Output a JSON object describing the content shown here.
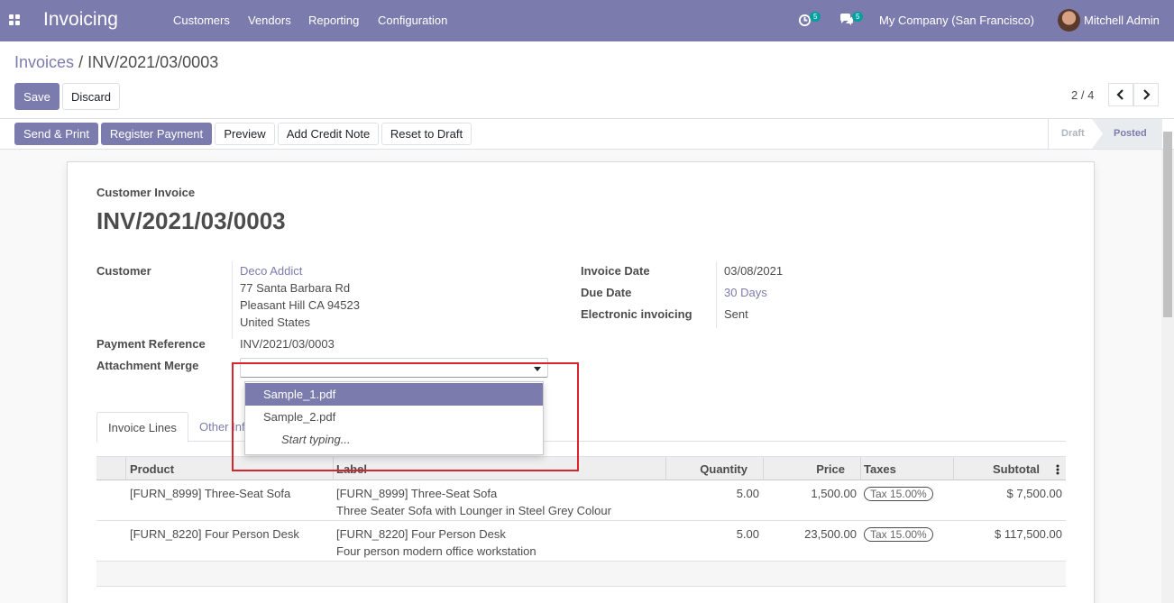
{
  "navbar": {
    "brand": "Invoicing",
    "menu": [
      "Customers",
      "Vendors",
      "Reporting",
      "Configuration"
    ],
    "activity_count": "5",
    "message_count": "5",
    "company": "My Company (San Francisco)",
    "user": "Mitchell Admin",
    "bg_color": "#7c7bad"
  },
  "breadcrumb": {
    "parent": "Invoices",
    "separator": "/",
    "current": "INV/2021/03/0003"
  },
  "actions": {
    "save": "Save",
    "discard": "Discard"
  },
  "pager": {
    "text": "2 / 4",
    "prev": "‹",
    "next": "›"
  },
  "status_buttons": [
    "Send & Print",
    "Register Payment",
    "Preview",
    "Add Credit Note",
    "Reset to Draft"
  ],
  "status_steps": {
    "draft": "Draft",
    "posted": "Posted",
    "current": "Posted"
  },
  "form": {
    "doc_type": "Customer Invoice",
    "number": "INV/2021/03/0003",
    "customer_label": "Customer",
    "customer_name": "Deco Addict",
    "address": [
      "77 Santa Barbara Rd",
      "Pleasant Hill CA 94523",
      "United States"
    ],
    "payment_ref_label": "Payment Reference",
    "payment_ref": "INV/2021/03/0003",
    "attachment_label": "Attachment Merge",
    "invoice_date_label": "Invoice Date",
    "invoice_date": "03/08/2021",
    "due_date_label": "Due Date",
    "due_date": "30 Days",
    "einvoicing_label": "Electronic invoicing",
    "einvoicing": "Sent"
  },
  "dropdown": {
    "options": [
      "Sample_1.pdf",
      "Sample_2.pdf"
    ],
    "hint": "Start typing...",
    "highlighted": "Sample_1.pdf"
  },
  "tabs": {
    "active": "Invoice Lines",
    "other": "Other Inf"
  },
  "table": {
    "columns": [
      "Product",
      "Label",
      "Quantity",
      "Price",
      "Taxes",
      "Subtotal"
    ],
    "rows": [
      {
        "product": "[FURN_8999] Three-Seat Sofa",
        "label1": "[FURN_8999] Three-Seat Sofa",
        "label2": "Three Seater Sofa with Lounger in Steel Grey Colour",
        "quantity": "5.00",
        "price": "1,500.00",
        "tax": "Tax 15.00%",
        "subtotal": "$ 7,500.00"
      },
      {
        "product": "[FURN_8220] Four Person Desk",
        "label1": "[FURN_8220] Four Person Desk",
        "label2": "Four person modern office workstation",
        "quantity": "5.00",
        "price": "23,500.00",
        "tax": "Tax 15.00%",
        "subtotal": "$ 117,500.00"
      }
    ]
  }
}
